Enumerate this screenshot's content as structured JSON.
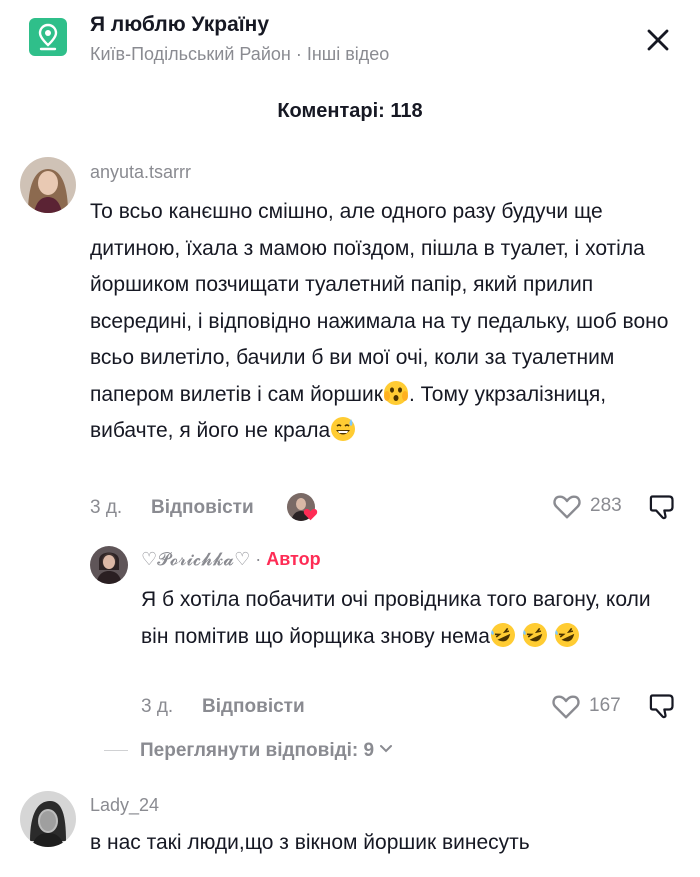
{
  "header": {
    "title": "Я люблю Україну",
    "subtitle": "Київ-Подільський Район · Інші відео",
    "location_icon": "location-pin-icon",
    "close_icon": "close-icon"
  },
  "comments_header": "Коментарі: 118",
  "colors": {
    "accent": "#fe2c55",
    "location_badge": "#2fbf8a",
    "muted": "#8a8b91",
    "text": "#161823"
  },
  "comments": [
    {
      "username": "anyuta.tsarrr",
      "text_part1": "То всьо канєшно смішно, але одного разу будучи ще дитиною, їхала з мамою поїздом, пішла в туалет, і хотіла йоршиком позчищати туалетний папір, який прилип всередині, і відповідно нажимала на ту педальку, шоб воно всьо вилетіло, бачили б ви мої очі, коли за туалетним папером вилетів і сам йоршик",
      "emoji1": "😱",
      "text_part2": ". Тому укрзалізниця, вибачте, я його не крала",
      "emoji2": "😅",
      "time": "3 д.",
      "reply_label": "Відповісти",
      "likes": "283"
    },
    {
      "username": "♡𝓟𝓸𝓻𝓲𝓬𝓱𝓴𝓪♡",
      "author_label": "Автор",
      "text": "Я б хотіла побачити очі провідника того вагону, коли він помітив що йорщика знову нема",
      "emojis": [
        "🤣",
        "🤣",
        "🤣"
      ],
      "time": "3 д.",
      "reply_label": "Відповісти",
      "likes": "167"
    },
    {
      "username": "Lady_24",
      "text": "в нас такі люди,що з вікном йоршик винесуть"
    }
  ],
  "view_replies": "Переглянути відповіді: 9"
}
